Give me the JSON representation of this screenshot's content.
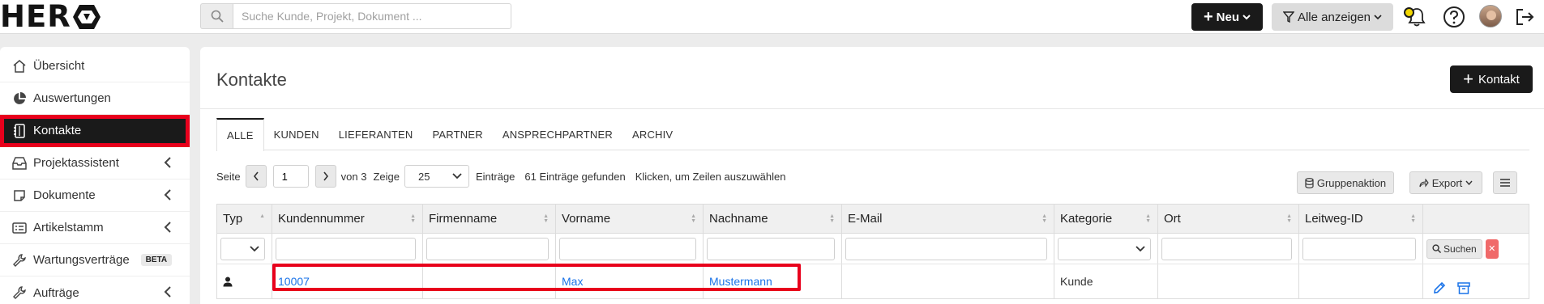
{
  "header": {
    "logo_text": "HER",
    "search_placeholder": "Suche Kunde, Projekt, Dokument ...",
    "new_label": "Neu",
    "filter_label": "Alle anzeigen"
  },
  "sidebar": {
    "items": [
      {
        "label": "Übersicht",
        "icon": "home-icon"
      },
      {
        "label": "Auswertungen",
        "icon": "pie-chart-icon"
      },
      {
        "label": "Kontakte",
        "icon": "address-book-icon",
        "active": true
      },
      {
        "label": "Projektassistent",
        "icon": "inbox-icon",
        "chevron": true
      },
      {
        "label": "Dokumente",
        "icon": "document-icon",
        "chevron": true
      },
      {
        "label": "Artikelstamm",
        "icon": "list-icon",
        "chevron": true
      },
      {
        "label": "Wartungsverträge",
        "icon": "wrench-icon",
        "badge": "BETA"
      },
      {
        "label": "Aufträge",
        "icon": "wrench-icon",
        "chevron": true
      }
    ]
  },
  "main": {
    "title": "Kontakte",
    "add_contact_label": "Kontakt",
    "tabs": [
      "ALLE",
      "KUNDEN",
      "LIEFERANTEN",
      "PARTNER",
      "ANSPRECHPARTNER",
      "ARCHIV"
    ],
    "active_tab": "ALLE",
    "pager": {
      "page_label": "Seite",
      "page_value": "1",
      "of_label": "von 3",
      "show_label": "Zeige",
      "page_size": "25",
      "entries_label": "Einträge",
      "found_label": "61 Einträge gefunden",
      "hint": "Klicken, um Zeilen auszuwählen"
    },
    "group_action_label": "Gruppenaktion",
    "export_label": "Export",
    "table": {
      "columns": [
        "Typ",
        "Kundennummer",
        "Firmenname",
        "Vorname",
        "Nachname",
        "E-Mail",
        "Kategorie",
        "Ort",
        "Leitweg-ID",
        ""
      ],
      "search_label": "Suchen",
      "rows": [
        {
          "typ_icon": "person-icon",
          "kundennummer": "10007",
          "firmenname": "",
          "vorname": "Max",
          "nachname": "Mustermann",
          "email": "",
          "kategorie": "Kunde",
          "ort": "",
          "leitweg": ""
        }
      ]
    }
  }
}
